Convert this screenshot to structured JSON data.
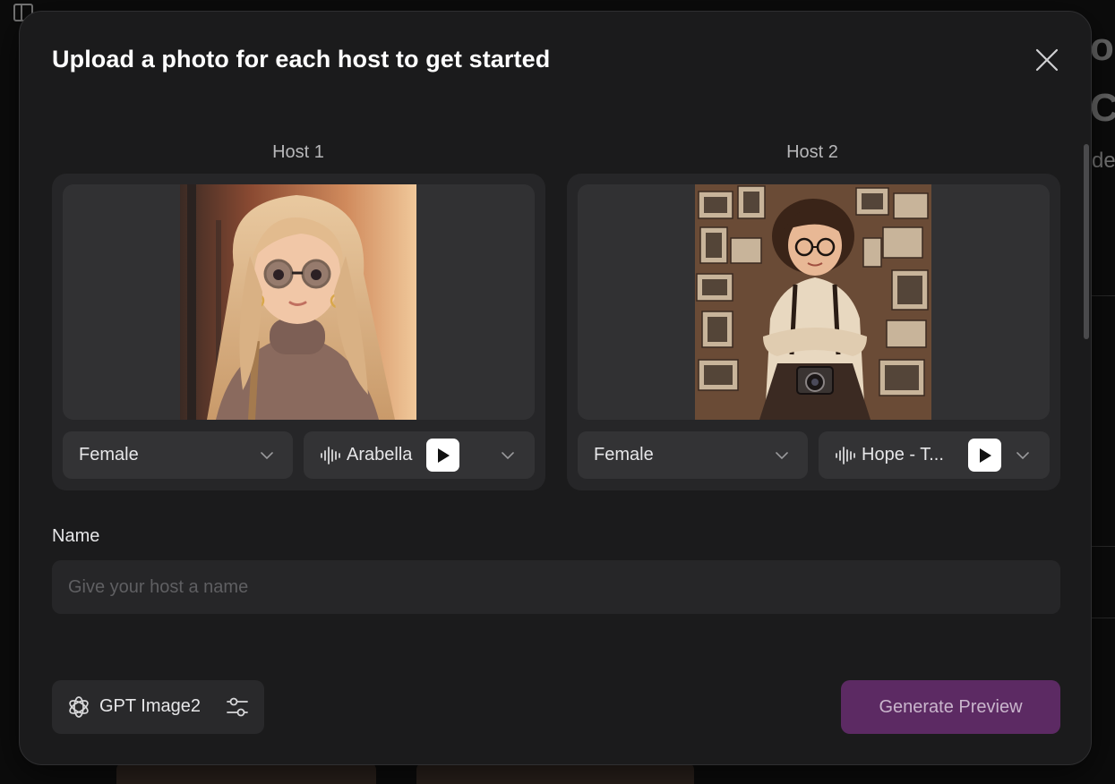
{
  "modal": {
    "title": "Upload a photo for each host to get started",
    "close_icon": "close-icon"
  },
  "hosts": [
    {
      "label": "Host 1",
      "gender": "Female",
      "voice": "Arabella",
      "voice_icon": "sound-wave-icon",
      "play_icon": "play-icon",
      "chevron_icon": "chevron-down-icon"
    },
    {
      "label": "Host 2",
      "gender": "Female",
      "voice": "Hope - T...",
      "voice_icon": "sound-wave-icon",
      "play_icon": "play-icon",
      "chevron_icon": "chevron-down-icon"
    }
  ],
  "name_field": {
    "label": "Name",
    "placeholder": "Give your host a name",
    "value": ""
  },
  "footer": {
    "model_label": "GPT Image2",
    "model_icon": "openai-logo-icon",
    "settings_icon": "sliders-icon",
    "generate_label": "Generate Preview"
  },
  "colors": {
    "modal_bg": "#1b1b1c",
    "card_bg": "#262628",
    "accent": "#5c2a63"
  }
}
